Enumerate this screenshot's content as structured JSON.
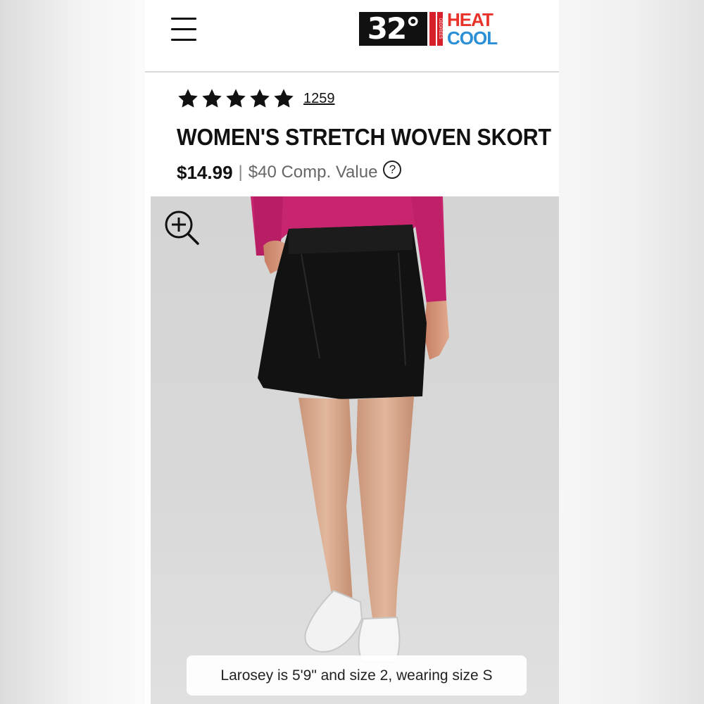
{
  "brand": {
    "logo_number": "32°",
    "logo_degrees": "DEGREES",
    "logo_heat": "HEAT",
    "logo_cool": "COOL",
    "colors": {
      "heat": "#e8322a",
      "cool": "#2a8fd6",
      "bar": "#d6202a"
    }
  },
  "header": {
    "menu_icon": "hamburger-menu-icon"
  },
  "product": {
    "rating_stars": 5,
    "review_count": "1259",
    "title": "WOMEN'S STRETCH WOVEN SKORT",
    "price": "$14.99",
    "separator": "|",
    "comp_value": "$40 Comp. Value",
    "info_icon_glyph": "?"
  },
  "gallery": {
    "zoom_icon": "zoom-in-icon",
    "caption": "Larosey is 5'9\" and size 2, wearing size S"
  }
}
